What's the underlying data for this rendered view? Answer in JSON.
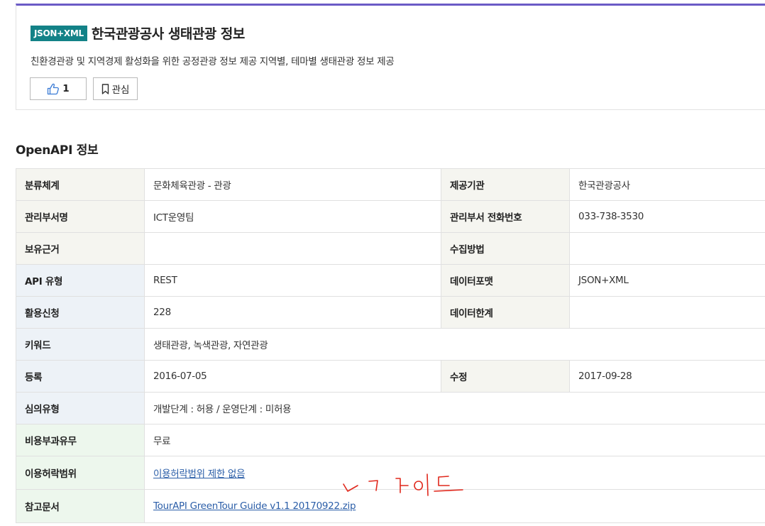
{
  "header": {
    "badge": "JSON+XML",
    "title": "한국관광공사 생태관광 정보",
    "description": "친환경관광 및 지역경제 활성화을 위한 공정관광 정보 제공 지역별, 테마별 생태관광 정보 제공",
    "like_count": "1",
    "favorite_label": "관심"
  },
  "section_title": "OpenAPI 정보",
  "table": {
    "r1": {
      "k1": "분류체계",
      "v1": "문화체육관광 - 관광",
      "k2": "제공기관",
      "v2": "한국관광공사"
    },
    "r2": {
      "k1": "관리부서명",
      "v1": "ICT운영팀",
      "k2": "관리부서 전화번호",
      "v2": "033-738-3530"
    },
    "r3": {
      "k1": "보유근거",
      "v1": "",
      "k2": "수집방법",
      "v2": ""
    },
    "r4": {
      "k1": "API 유형",
      "v1": "REST",
      "k2": "데이터포맷",
      "v2": "JSON+XML"
    },
    "r5": {
      "k1": "활용신청",
      "v1": "228",
      "k2": "데이터한계",
      "v2": ""
    },
    "r6": {
      "k1": "키워드",
      "v1": "생태관광, 녹색관광, 자연관광"
    },
    "r7": {
      "k1": "등록",
      "v1": "2016-07-05",
      "k2": "수정",
      "v2": "2017-09-28"
    },
    "r8": {
      "k1": "심의유형",
      "v1": "개발단계 : 허용 / 운영단계 : 미허용"
    },
    "r9": {
      "k1": "비용부과유무",
      "v1": "무료"
    },
    "r10": {
      "k1": "이용허락범위",
      "v1": "이용허락범위 제한 없음"
    },
    "r11": {
      "k1": "참고문서",
      "v1": "TourAPI GreenTour Guide v1.1 20170922.zip"
    }
  },
  "colors": {
    "accent": "#6b5bc6",
    "badge": "#138287",
    "annotation": "#e0281c"
  },
  "icons": [
    "thumbs-up-icon",
    "bookmark-icon"
  ]
}
